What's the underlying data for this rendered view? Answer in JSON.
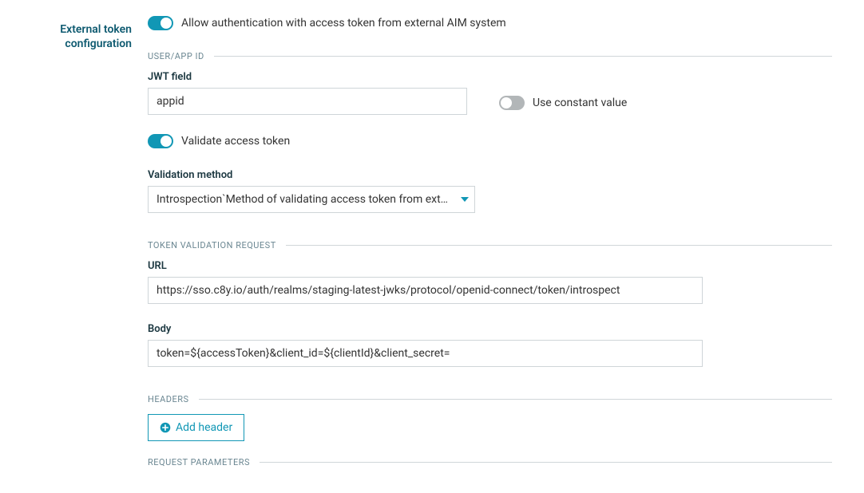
{
  "section_title": "External token configuration",
  "allow_auth": {
    "label": "Allow authentication with access token from external AIM system",
    "on": true
  },
  "user_app_id": {
    "legend": "USER/APP ID",
    "jwt_field_label": "JWT field",
    "jwt_field_value": "appid",
    "use_constant_label": "Use constant value",
    "use_constant_on": false
  },
  "validate_toggle": {
    "label": "Validate access token",
    "on": true
  },
  "validation_method": {
    "label": "Validation method",
    "selected": "Introspection`Method of validating access token from external AIM system"
  },
  "token_validation_request": {
    "legend": "TOKEN VALIDATION REQUEST",
    "url_label": "URL",
    "url_value": "https://sso.c8y.io/auth/realms/staging-latest-jwks/protocol/openid-connect/token/introspect",
    "body_label": "Body",
    "body_value": "token=${accessToken}&client_id=${clientId}&client_secret="
  },
  "headers": {
    "legend": "HEADERS",
    "add_button_label": "Add header"
  },
  "request_parameters": {
    "legend": "REQUEST PARAMETERS"
  }
}
